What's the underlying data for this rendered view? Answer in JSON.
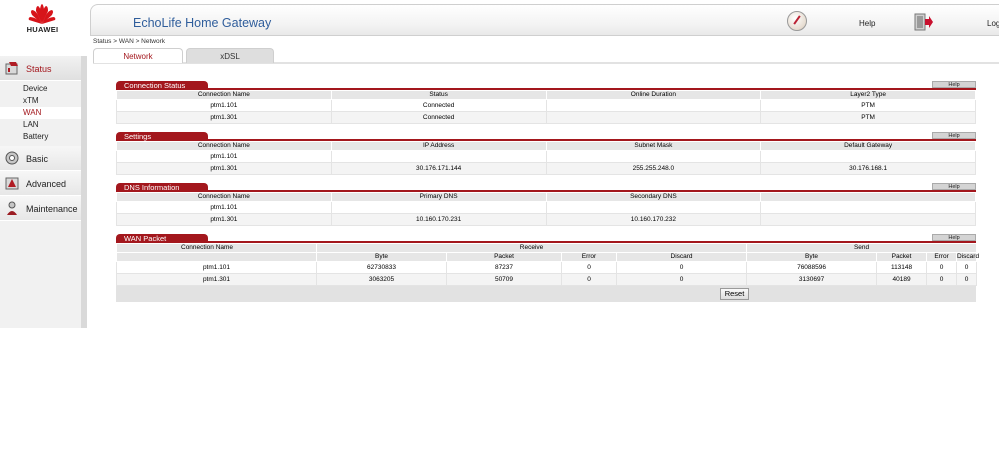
{
  "brand": {
    "logo_text": "HUAWEI"
  },
  "header": {
    "title": "EchoLife Home Gateway",
    "help_label": "Help",
    "logout_label": "Log"
  },
  "breadcrumb": "Status > WAN > Network",
  "tabs": [
    {
      "label": "Network"
    },
    {
      "label": "xDSL"
    }
  ],
  "sidebar": {
    "status": {
      "label": "Status",
      "items": [
        "Device",
        "xTM",
        "WAN",
        "LAN",
        "Battery"
      ]
    },
    "basic": {
      "label": "Basic"
    },
    "advanced": {
      "label": "Advanced"
    },
    "maintenance": {
      "label": "Maintenance"
    }
  },
  "help_button": "Help",
  "connection_status": {
    "title": "Connection Status",
    "headers": [
      "Connection Name",
      "Status",
      "Online Duration",
      "Layer2 Type"
    ],
    "rows": [
      [
        "ptm1.101",
        "Connected",
        "",
        "PTM"
      ],
      [
        "ptm1.301",
        "Connected",
        "",
        "PTM"
      ]
    ]
  },
  "settings": {
    "title": "Settings",
    "headers": [
      "Connection Name",
      "IP Address",
      "Subnet Mask",
      "Default Gateway"
    ],
    "rows": [
      [
        "ptm1.101",
        "",
        "",
        ""
      ],
      [
        "ptm1.301",
        "30.176.171.144",
        "255.255.248.0",
        "30.176.168.1"
      ]
    ]
  },
  "dns": {
    "title": "DNS Information",
    "headers": [
      "Connection Name",
      "Primary DNS",
      "Secondary DNS",
      ""
    ],
    "rows": [
      [
        "ptm1.101",
        "",
        "",
        ""
      ],
      [
        "ptm1.301",
        "10.160.170.231",
        "10.160.170.232",
        ""
      ]
    ]
  },
  "wan_packet": {
    "title": "WAN Packet",
    "group_headers": {
      "connection_name": "Connection Name",
      "receive": "Receive",
      "send": "Send"
    },
    "sub_headers": [
      "Byte",
      "Packet",
      "Error",
      "Discard",
      "Byte",
      "Packet",
      "Error",
      "Discard"
    ],
    "rows": [
      [
        "ptm1.101",
        "62730833",
        "87237",
        "0",
        "0",
        "76088596",
        "113148",
        "0",
        "0"
      ],
      [
        "ptm1.301",
        "3063205",
        "50709",
        "0",
        "0",
        "3130697",
        "40189",
        "0",
        "0"
      ]
    ],
    "reset_label": "Reset"
  }
}
